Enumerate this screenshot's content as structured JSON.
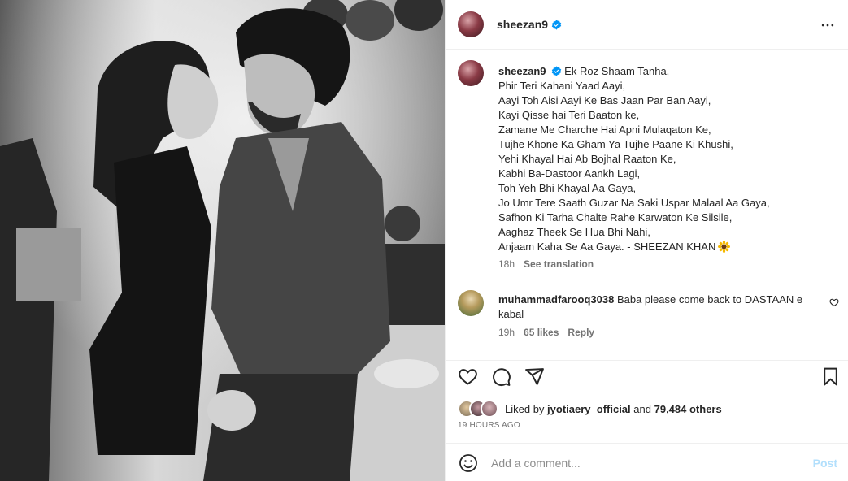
{
  "post": {
    "author": "sheezan9",
    "more_icon": "more-horizontal-icon",
    "verified_icon": "verified-badge-icon"
  },
  "caption": {
    "username": "sheezan9",
    "lines": [
      "Ek Roz Shaam Tanha,",
      "Phir Teri Kahani Yaad Aayi,",
      "Aayi Toh Aisi Aayi Ke Bas Jaan Par Ban Aayi,",
      "Kayi Qisse hai Teri Baaton ke,",
      "Zamane Me Charche Hai Apni Mulaqaton Ke,",
      "Tujhe Khone Ka Gham Ya Tujhe Paane Ki Khushi,",
      "Yehi Khayal Hai Ab Bojhal Raaton Ke,",
      "Kabhi Ba-Dastoor Aankh Lagi,",
      "Toh Yeh Bhi Khayal Aa Gaya,",
      "Jo Umr Tere Saath Guzar Na Saki Uspar Malaal Aa Gaya,",
      "Safhon Ki Tarha Chalte Rahe Karwaton Ke Silsile,",
      "Aaghaz Theek Se Hua Bhi Nahi,",
      "Anjaam Kaha Se Aa Gaya. - SHEEZAN KHAN"
    ],
    "emoji": "sunflower-emoji",
    "time": "18h",
    "see_translation": "See translation"
  },
  "comments": [
    {
      "username": "muhammadfarooq3038",
      "text": "Baba please come back to DASTAAN e kabal",
      "time": "19h",
      "likes": "65 likes",
      "reply": "Reply"
    }
  ],
  "actions": {
    "icons": [
      "heart-icon",
      "comment-icon",
      "share-icon",
      "bookmark-icon"
    ]
  },
  "likes": {
    "prefix": "Liked by",
    "user": "jyotiaery_official",
    "middle": "and",
    "count": "79,484 others"
  },
  "timestamp": "19 HOURS AGO",
  "add_comment": {
    "placeholder": "Add a comment...",
    "post_label": "Post"
  },
  "colors": {
    "text": "#262626",
    "secondary": "#737373",
    "verified": "#0095f6",
    "post_disabled": "#b2dffc",
    "divider": "#efefef"
  }
}
